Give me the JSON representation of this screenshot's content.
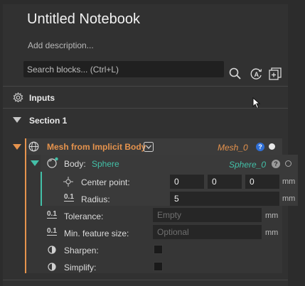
{
  "notebook": {
    "title": "Untitled Notebook",
    "description_placeholder": "Add description..."
  },
  "search": {
    "placeholder": "Search blocks... (Ctrl+L)"
  },
  "inputs": {
    "label": "Inputs"
  },
  "section": {
    "label": "Section 1"
  },
  "block": {
    "title": "Mesh from Implicit Body",
    "output_var": "Mesh_0",
    "help": "?"
  },
  "body_param": {
    "label": "Body:",
    "value": "Sphere",
    "output_var": "Sphere_0",
    "help": "?"
  },
  "center_point": {
    "label": "Center point:",
    "x": "0",
    "y": "0",
    "z": "0",
    "unit": "mm"
  },
  "radius": {
    "label": "Radius:",
    "value": "5",
    "unit": "mm",
    "type_badge": "0.1"
  },
  "tolerance": {
    "label": "Tolerance:",
    "placeholder": "Empty",
    "unit": "mm",
    "type_badge": "0.1"
  },
  "min_feature": {
    "label": "Min. feature size:",
    "placeholder": "Optional",
    "unit": "mm",
    "type_badge": "0.1"
  },
  "sharpen": {
    "label": "Sharpen:"
  },
  "simplify": {
    "label": "Simplify:"
  },
  "colors": {
    "accent_orange": "#e6934d",
    "accent_teal": "#43c0a8",
    "help_blue": "#2f6fd6",
    "panel": "#313131",
    "field": "#262626"
  }
}
